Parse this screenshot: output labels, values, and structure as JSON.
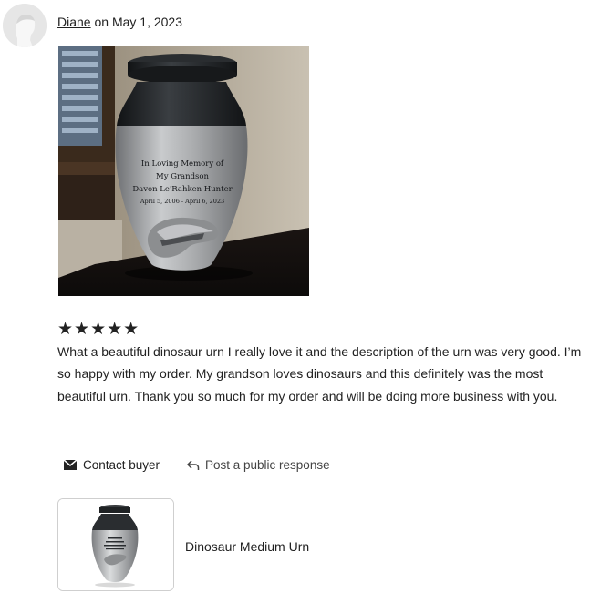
{
  "review": {
    "reviewer_name": "Diane",
    "date_text": "on May 1, 2023",
    "rating": "★★★★★",
    "text": "What a beautiful dinosaur urn I really love it and the description of the urn was very good. I’m so happy with my order. My grandson loves dinosaurs and this definitely was the most beautiful urn. Thank you so much for my order and will be doing more business with you.",
    "photo_engraving": [
      "In Loving Memory of",
      "My Grandson",
      "Davon Le'Rahken Hunter",
      "April 5, 2006 - April 6, 2023"
    ]
  },
  "actions": {
    "contact_label": "Contact buyer",
    "contact_icon": "envelope-icon",
    "public_label": "Post a public response",
    "public_icon": "reply-arrow-icon"
  },
  "product": {
    "title": "Dinosaur Medium Urn"
  },
  "colors": {
    "text": "#222222",
    "urn_silver": "#a7a9ac",
    "urn_black": "#1f2224"
  }
}
